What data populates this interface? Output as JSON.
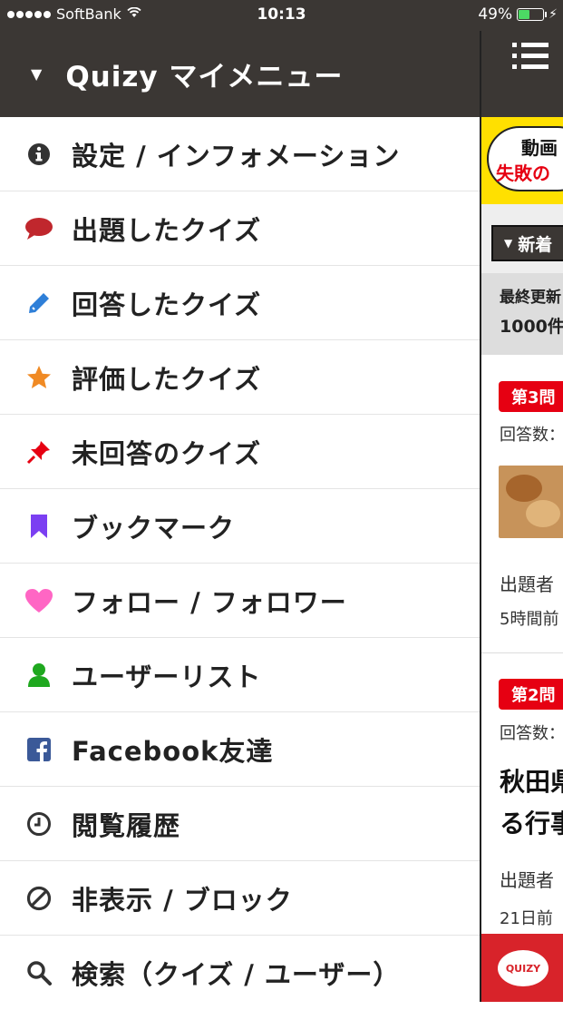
{
  "status_bar": {
    "carrier": "SoftBank",
    "time": "10:13",
    "battery_percent": "49%",
    "battery_level": 0.49
  },
  "drawer": {
    "title": "Quizy マイメニュー",
    "items": [
      {
        "label": "設定 / インフォメーション",
        "icon": "info-icon",
        "color": "#333333"
      },
      {
        "label": "出題したクイズ",
        "icon": "speech-bubble-icon",
        "color": "#c0272d"
      },
      {
        "label": "回答したクイズ",
        "icon": "pencil-icon",
        "color": "#2e7fd8"
      },
      {
        "label": "評価したクイズ",
        "icon": "star-icon",
        "color": "#f08a24"
      },
      {
        "label": "未回答のクイズ",
        "icon": "pushpin-icon",
        "color": "#e60012"
      },
      {
        "label": "ブックマーク",
        "icon": "bookmark-icon",
        "color": "#7b3ff2"
      },
      {
        "label": "フォロー / フォロワー",
        "icon": "heart-icon",
        "color": "#ff66c4"
      },
      {
        "label": "ユーザーリスト",
        "icon": "user-icon",
        "color": "#1fa81f"
      },
      {
        "label": "Facebook友達",
        "icon": "facebook-icon",
        "color": "#3b5998"
      },
      {
        "label": "閲覧履歴",
        "icon": "clock-icon",
        "color": "#333333"
      },
      {
        "label": "非表示 / ブロック",
        "icon": "ban-icon",
        "color": "#333333"
      },
      {
        "label": "検索（クイズ / ユーザー）",
        "icon": "search-icon",
        "color": "#333333"
      }
    ]
  },
  "main": {
    "banner_line1": "動画",
    "banner_line2": "失敗の",
    "sort_label": "新着",
    "info_line1": "最終更新",
    "info_line2": "1000件",
    "cards": [
      {
        "badge": "第3問",
        "answers": "回答数：",
        "author": "出題者",
        "time": "5時間前"
      },
      {
        "badge": "第2問",
        "answers": "回答数：",
        "title1": "秋田県",
        "title2": "る行事",
        "author": "出題者",
        "time": "21日前"
      }
    ],
    "footer_logo": "QUIZY"
  },
  "colors": {
    "header_bg": "#3b3734",
    "badge_red": "#e60012",
    "banner_yellow": "#ffe000"
  }
}
